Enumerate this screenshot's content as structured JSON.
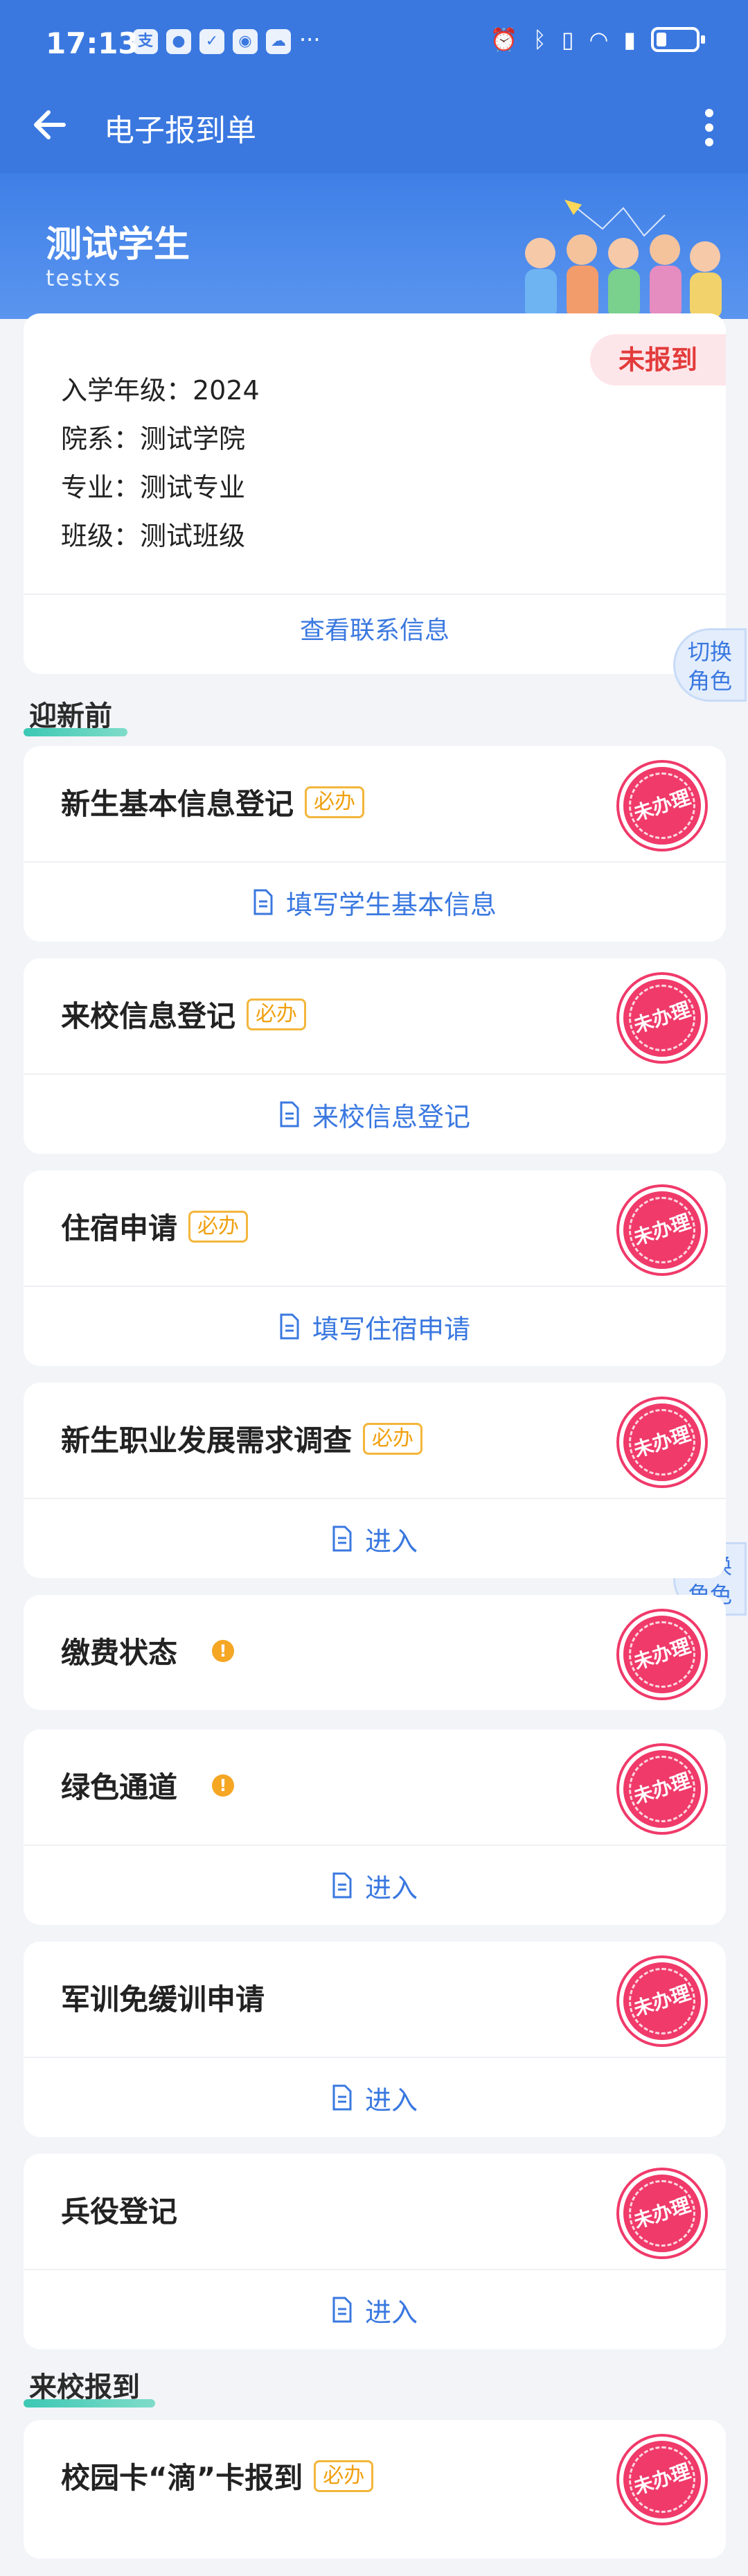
{
  "status_bar": {
    "time": "17:13",
    "apps": [
      "支",
      "●",
      "✓",
      "◉",
      "☁"
    ],
    "more": "···"
  },
  "navbar": {
    "title": "电子报到单"
  },
  "banner": {
    "name": "测试学生",
    "id": "testxs"
  },
  "info": {
    "status_badge": "未报到",
    "grade": "入学年级：2024",
    "department": "院系：测试学院",
    "major": "专业：测试专业",
    "class": "班级：测试班级",
    "contact_link": "查看联系信息"
  },
  "switch_role": {
    "line1": "切换",
    "line2": "角色"
  },
  "sections": {
    "pre": "迎新前",
    "arrive": "来校报到"
  },
  "required_tag": "必办",
  "stamp_text": "未办理",
  "tasks": [
    {
      "title": "新生基本信息登记",
      "action": "填写学生基本信息"
    },
    {
      "title": "来校信息登记",
      "action": "来校信息登记"
    },
    {
      "title": "住宿申请",
      "action": "填写住宿申请"
    },
    {
      "title": "新生职业发展需求调查",
      "action": "进入"
    },
    {
      "title": "缴费状态",
      "warn": "!"
    },
    {
      "title": "绿色通道",
      "warn": "!",
      "action": "进入"
    },
    {
      "title": "军训免缓训申请",
      "action": "进入"
    },
    {
      "title": "兵役登记",
      "action": "进入"
    },
    {
      "title": "校园卡“滴”卡报到"
    }
  ]
}
